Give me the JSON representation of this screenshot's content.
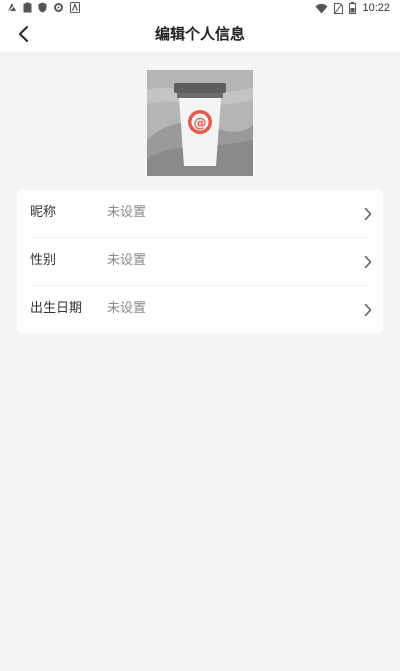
{
  "status_bar": {
    "time": "10:22",
    "left_icons": [
      "notification-icon",
      "clipboard-icon",
      "shield-icon",
      "settings-icon",
      "android-icon"
    ],
    "right_icons": [
      "wifi-icon",
      "sim-icon",
      "battery-icon"
    ]
  },
  "header": {
    "title": "编辑个人信息",
    "back_icon": "back-arrow-icon"
  },
  "avatar": {
    "icon": "coffee-cup-avatar",
    "accent_color": "#e05a4f"
  },
  "profile_fields": [
    {
      "label": "昵称",
      "value": "未设置"
    },
    {
      "label": "性别",
      "value": "未设置"
    },
    {
      "label": "出生日期",
      "value": "未设置"
    }
  ],
  "colors": {
    "background": "#f4f5f7",
    "card": "#ffffff",
    "value_text": "#8a8a8a"
  }
}
